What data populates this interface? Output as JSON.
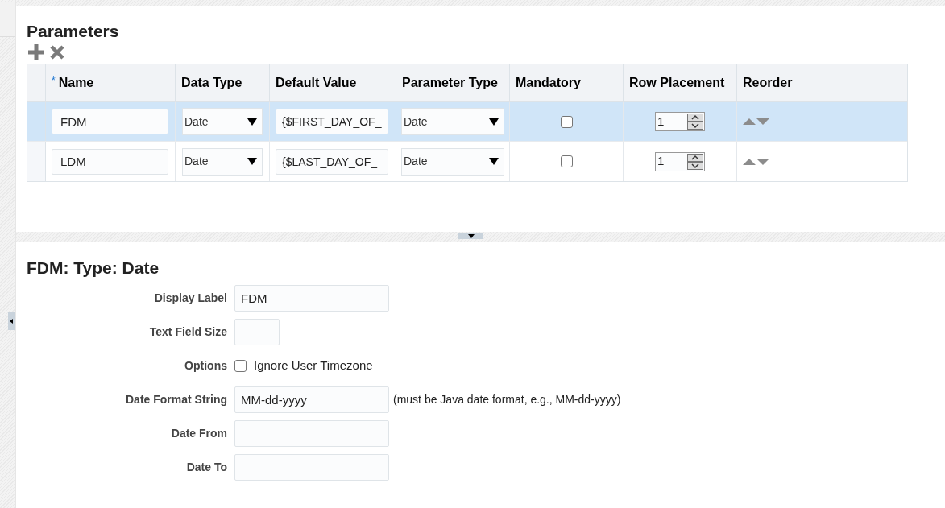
{
  "parameters": {
    "title": "Parameters",
    "columns": [
      {
        "label": "Name",
        "required_mark": "*"
      },
      {
        "label": "Data Type"
      },
      {
        "label": "Default Value"
      },
      {
        "label": "Parameter Type"
      },
      {
        "label": "Mandatory"
      },
      {
        "label": "Row Placement"
      },
      {
        "label": "Reorder"
      }
    ],
    "rows": [
      {
        "selected": true,
        "name": "FDM",
        "data_type": "Date",
        "default_value": "{$FIRST_DAY_OF_",
        "parameter_type": "Date",
        "mandatory": false,
        "row_placement": "1"
      },
      {
        "selected": false,
        "name": "LDM",
        "data_type": "Date",
        "default_value": "{$LAST_DAY_OF_",
        "parameter_type": "Date",
        "mandatory": false,
        "row_placement": "1"
      }
    ]
  },
  "detail": {
    "title": "FDM: Type: Date",
    "fields": [
      {
        "kind": "text",
        "label": "Display Label",
        "value": "FDM"
      },
      {
        "kind": "short_text",
        "label": "Text Field Size"
      },
      {
        "kind": "checkbox",
        "label": "Options",
        "option": "Ignore User Timezone",
        "checked": false
      },
      {
        "kind": "text",
        "label": "Date Format String",
        "value": "MM-dd-yyyy",
        "note": "(must be Java date format, e.g., MM-dd-yyyy)"
      },
      {
        "kind": "text",
        "label": "Date From"
      },
      {
        "kind": "text",
        "label": "Date To"
      }
    ]
  }
}
